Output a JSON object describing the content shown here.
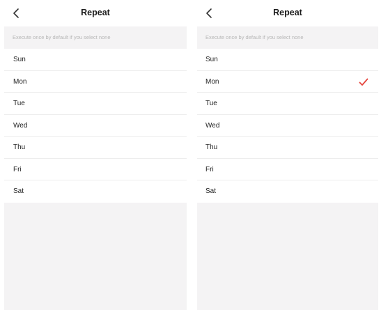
{
  "screens": [
    {
      "title": "Repeat",
      "hint": "Execute once by default if you select none",
      "days": [
        {
          "label": "Sun",
          "selected": false
        },
        {
          "label": "Mon",
          "selected": false
        },
        {
          "label": "Tue",
          "selected": false
        },
        {
          "label": "Wed",
          "selected": false
        },
        {
          "label": "Thu",
          "selected": false
        },
        {
          "label": "Fri",
          "selected": false
        },
        {
          "label": "Sat",
          "selected": false
        }
      ]
    },
    {
      "title": "Repeat",
      "hint": "Execute once by default if you select none",
      "days": [
        {
          "label": "Sun",
          "selected": false
        },
        {
          "label": "Mon",
          "selected": true
        },
        {
          "label": "Tue",
          "selected": false
        },
        {
          "label": "Wed",
          "selected": false
        },
        {
          "label": "Thu",
          "selected": false
        },
        {
          "label": "Fri",
          "selected": false
        },
        {
          "label": "Sat",
          "selected": false
        }
      ]
    }
  ],
  "icons": {
    "back": "chevron-left-icon",
    "check": "checkmark-icon"
  },
  "colors": {
    "check": "#e5453d",
    "background": "#f4f3f4",
    "hint_text": "#b7b7b7"
  }
}
